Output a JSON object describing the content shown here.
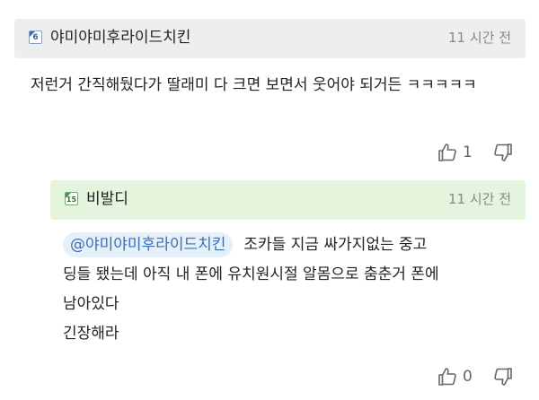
{
  "comment": {
    "badge_level": "6",
    "author": "야미야미후라이드치킨",
    "time": "11 시간 전",
    "text": "저런거 간직해뒀다가 딸래미 다 크면 보면서 웃어야 되거든 ㅋㅋㅋㅋㅋ",
    "likes": "1",
    "like_icon": "thumbs-up-icon",
    "dislike_icon": "thumbs-down-icon"
  },
  "reply": {
    "badge_level": "15",
    "author": "비발디",
    "time": "11 시간 전",
    "mention": "@야미야미후라이드치킨",
    "line1": "조카들 지금 싸가지없는 중고",
    "line2": "딩들 됐는데 아직 내 폰에 유치원시절 알몸으로 춤춘거 폰에",
    "line3": "남아있다",
    "line4": "긴장해라",
    "likes": "0",
    "like_icon": "thumbs-up-icon",
    "dislike_icon": "thumbs-down-icon"
  },
  "colors": {
    "comment_header_bg": "#eeeeee",
    "reply_header_bg": "#e5f4dd",
    "mention_bg": "#e6f0fb",
    "mention_text": "#3a6fb0",
    "muted_text": "#888888"
  }
}
